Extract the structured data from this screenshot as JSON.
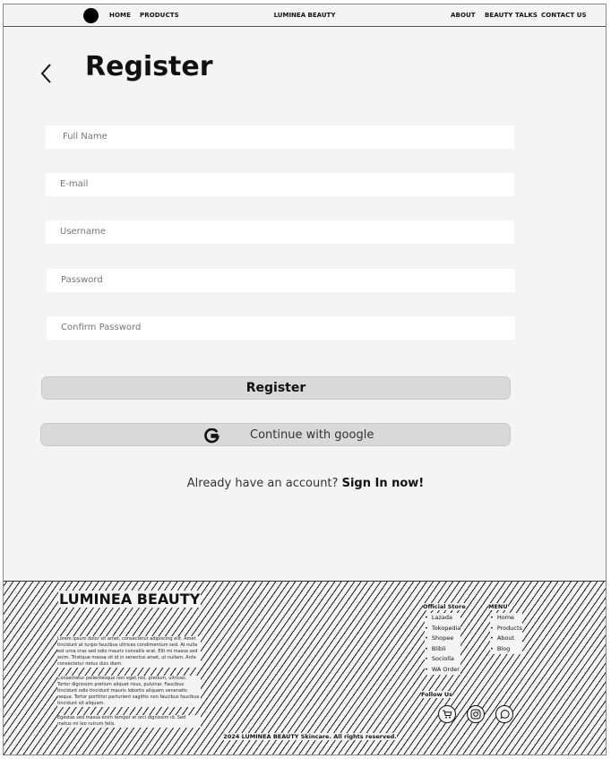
{
  "header": {
    "brand": "LUMINEA BEAUTY",
    "nav_left": [
      "HOME",
      "PRODUCTS"
    ],
    "nav_right": [
      "ABOUT",
      "BEAUTY TALKS",
      "CONTACT US"
    ]
  },
  "page": {
    "title": "Register"
  },
  "form": {
    "full_name_placeholder": "Full Name",
    "email_placeholder": "E-mail",
    "username_placeholder": "Username",
    "password_placeholder": "Password",
    "confirm_password_placeholder": "Confirm Password",
    "register_label": "Register",
    "google_label": "Continue with google",
    "already_text": "Already have an account?",
    "sign_in_label": "Sign In now!"
  },
  "footer": {
    "brand": "LUMINEA BEAUTY",
    "paragraphs": [
      "Lorem ipsum dolor sit amet, consectetur adipiscing elit. Amet tincidunt at turpis faucibus ultrices condimentum sed. At nulla est urna cras sed odio mauris convallis erat. Elit mi massa sed enim. Tristique massa sit id in senectus amet, ut nullam. Ante consectetur netus duis diam.",
      "Consectetur pellentesque non eget nisl, pretium, ultrices. Tortor dignissim pretium aliquet risus, pulvinar. Faucibus tincidunt odio tincidunt mauris lobortis aliquam venenatis neque. Tortor porttitor parturient sagittis non faucibus faucibus tincidunt sit aliquam.",
      "Egestas sed massa enim tempor at orci dignissim id. Sed metus mi leo rutrum felis."
    ],
    "official_store_title": "Official Store",
    "official_store": [
      "Lazada",
      "Tokopedia",
      "Shopee",
      "Blibli",
      "Sociolla",
      "WA Order"
    ],
    "menu_title": "MENU",
    "menu": [
      "Home",
      "Products",
      "About",
      "Blog"
    ],
    "follow_title": "Follow Us",
    "social_icons": [
      "shopping-cart-icon",
      "instagram-icon",
      "whatsapp-icon"
    ],
    "copyright": "2024 LUMINEA BEAUTY Skincare. All rights reserved."
  }
}
